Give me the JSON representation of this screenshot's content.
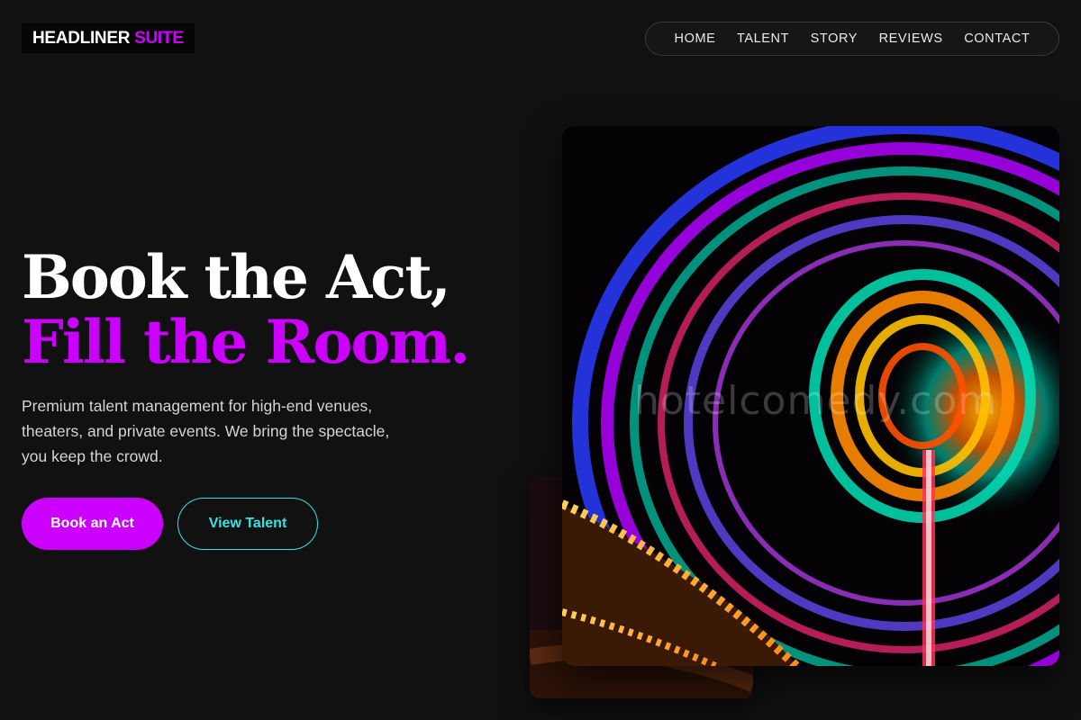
{
  "header": {
    "logo_part1": "HEADLINER",
    "logo_part2": "SUITE",
    "nav": [
      "HOME",
      "TALENT",
      "STORY",
      "REVIEWS",
      "CONTACT"
    ]
  },
  "hero": {
    "headline_line1": "Book the Act,",
    "headline_line2": "Fill the Room.",
    "subtext": "Premium talent management for high-end venues, theaters, and private events. We bring the spectacle, you keep the crowd.",
    "primary_button": "Book an Act",
    "secondary_button": "View Talent",
    "image_watermark": "hotelcomedy.com"
  },
  "colors": {
    "background": "#111111",
    "accent_magenta": "#cc00ff",
    "accent_cyan": "#2ee6e6"
  },
  "icons": {
    "hero_image": "ferris-wheel-light-trails-photo"
  }
}
